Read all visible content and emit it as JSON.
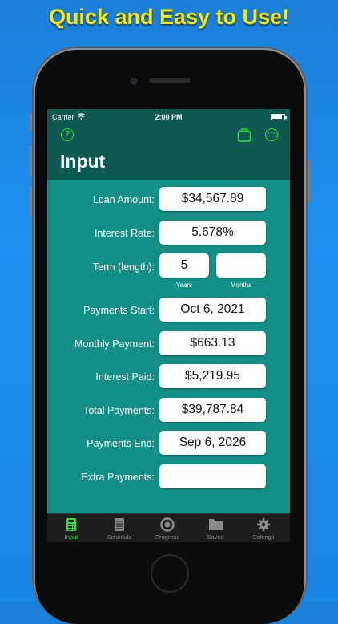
{
  "headline": "Quick and Easy to Use!",
  "status": {
    "carrier": "Carrier",
    "time": "2:00 PM"
  },
  "nav": {
    "title": "Input",
    "help": "?",
    "more": "···"
  },
  "form": {
    "loan_amount_label": "Loan Amount:",
    "loan_amount_value": "$34,567.89",
    "interest_rate_label": "Interest Rate:",
    "interest_rate_value": "5.678%",
    "term_label": "Term (length):",
    "term_years_value": "5",
    "term_years_label": "Years",
    "term_months_value": "",
    "term_months_label": "Months",
    "payments_start_label": "Payments Start:",
    "payments_start_value": "Oct 6, 2021",
    "monthly_payment_label": "Monthly Payment:",
    "monthly_payment_value": "$663.13",
    "interest_paid_label": "Interest Paid:",
    "interest_paid_value": "$5,219.95",
    "total_payments_label": "Total Payments:",
    "total_payments_value": "$39,787.84",
    "payments_end_label": "Payments End:",
    "payments_end_value": "Sep 6, 2026",
    "extra_payments_label": "Extra Payments:",
    "extra_payments_value": ""
  },
  "tabs": [
    {
      "label": "Input",
      "icon": "calculator-icon",
      "active": true
    },
    {
      "label": "Schedule",
      "icon": "schedule-icon",
      "active": false
    },
    {
      "label": "Progress",
      "icon": "progress-icon",
      "active": false
    },
    {
      "label": "Saved",
      "icon": "folder-icon",
      "active": false
    },
    {
      "label": "Settings",
      "icon": "gear-icon",
      "active": false
    }
  ],
  "colors": {
    "accent": "#36e03a",
    "screen_bg": "#138f85",
    "header_bg": "#0e5a50",
    "headline": "#ffe800"
  }
}
